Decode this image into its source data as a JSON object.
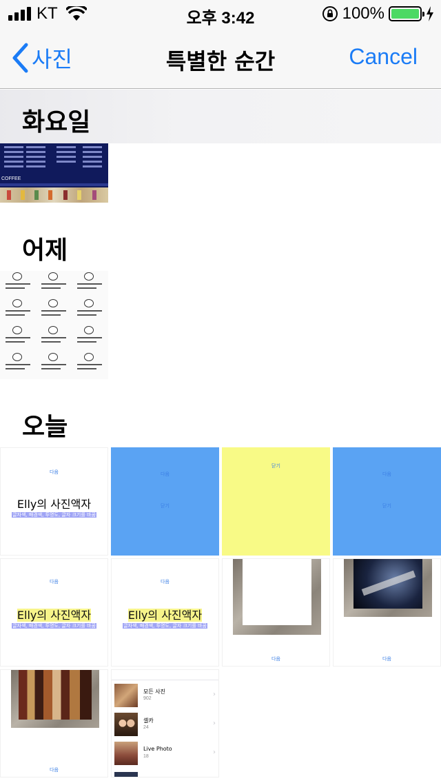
{
  "status_bar": {
    "carrier": "KT",
    "time": "오후 3:42",
    "battery_percent": "100%",
    "battery_level": 1.0,
    "battery_color": "#4cd964"
  },
  "nav": {
    "back_label": "사진",
    "back_icon": "chevron-left-icon",
    "title": "특별한 순간",
    "cancel_label": "Cancel",
    "accent_color": "#1b7cf6"
  },
  "sections": [
    {
      "title": "화요일"
    },
    {
      "title": "어제"
    },
    {
      "title": "오늘"
    }
  ],
  "tiles": {
    "coffee_brand": "COFFEE",
    "frame_title": "Elly의 사진액자",
    "frame_subtitle": "글자색, 배경색, 투명도, 글자 크기를 바꿈",
    "next_label": "다음",
    "close_label": "닫기",
    "albums": [
      {
        "name": "모든 사진",
        "count": "902"
      },
      {
        "name": "셀카",
        "count": "24"
      },
      {
        "name": "Live Photo",
        "count": "18"
      }
    ]
  }
}
